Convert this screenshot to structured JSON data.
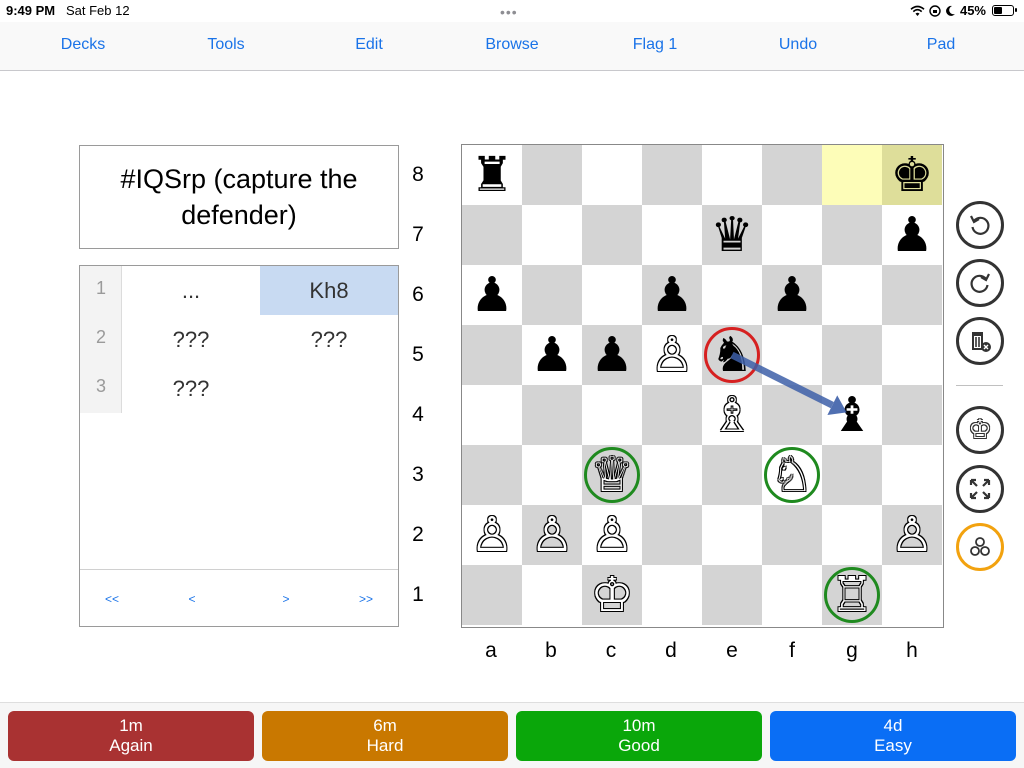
{
  "status_bar": {
    "time": "9:49 PM",
    "date": "Sat Feb 12",
    "battery": "45%",
    "battery_level": 0.45
  },
  "toolbar": {
    "items": [
      {
        "label": "Decks"
      },
      {
        "label": "Tools"
      },
      {
        "label": "Edit"
      },
      {
        "label": "Browse"
      },
      {
        "label": "Flag 1"
      },
      {
        "label": "Undo"
      },
      {
        "label": "Pad"
      }
    ],
    "color": "#1a73e8"
  },
  "question": {
    "text": "#IQSrp (capture the defender)"
  },
  "moves": {
    "rows": [
      {
        "num": "1",
        "white": "...",
        "black": "Kh8",
        "selected": "black"
      },
      {
        "num": "2",
        "white": "???",
        "black": "???"
      },
      {
        "num": "3",
        "white": "???",
        "black": ""
      }
    ],
    "nav": {
      "first": "<<",
      "prev": "<",
      "next": ">",
      "last": ">>"
    }
  },
  "board": {
    "ranks": [
      "8",
      "7",
      "6",
      "5",
      "4",
      "3",
      "2",
      "1"
    ],
    "files": [
      "a",
      "b",
      "c",
      "d",
      "e",
      "f",
      "g",
      "h"
    ],
    "highlight_squares": [
      "g8",
      "h8"
    ],
    "pieces": [
      {
        "sq": "a8",
        "glyph": "♜",
        "color": "black",
        "name": "black-rook"
      },
      {
        "sq": "h8",
        "glyph": "♚",
        "color": "black",
        "name": "black-king"
      },
      {
        "sq": "e7",
        "glyph": "♛",
        "color": "black",
        "name": "black-queen"
      },
      {
        "sq": "h7",
        "glyph": "♟",
        "color": "black",
        "name": "black-pawn"
      },
      {
        "sq": "a6",
        "glyph": "♟",
        "color": "black",
        "name": "black-pawn"
      },
      {
        "sq": "d6",
        "glyph": "♟",
        "color": "black",
        "name": "black-pawn"
      },
      {
        "sq": "f6",
        "glyph": "♟",
        "color": "black",
        "name": "black-pawn"
      },
      {
        "sq": "b5",
        "glyph": "♟",
        "color": "black",
        "name": "black-pawn"
      },
      {
        "sq": "c5",
        "glyph": "♟",
        "color": "black",
        "name": "black-pawn"
      },
      {
        "sq": "d5",
        "glyph": "♙",
        "color": "white",
        "name": "white-pawn"
      },
      {
        "sq": "e5",
        "glyph": "♞",
        "color": "black",
        "name": "black-knight",
        "ring": "red"
      },
      {
        "sq": "e4",
        "glyph": "♗",
        "color": "white",
        "name": "white-bishop"
      },
      {
        "sq": "g4",
        "glyph": "♝",
        "color": "black",
        "name": "black-bishop"
      },
      {
        "sq": "c3",
        "glyph": "♕",
        "color": "white",
        "name": "white-queen",
        "ring": "green"
      },
      {
        "sq": "f3",
        "glyph": "♘",
        "color": "white",
        "name": "white-knight",
        "ring": "green"
      },
      {
        "sq": "a2",
        "glyph": "♙",
        "color": "white",
        "name": "white-pawn"
      },
      {
        "sq": "b2",
        "glyph": "♙",
        "color": "white",
        "name": "white-pawn"
      },
      {
        "sq": "c2",
        "glyph": "♙",
        "color": "white",
        "name": "white-pawn"
      },
      {
        "sq": "h2",
        "glyph": "♙",
        "color": "white",
        "name": "white-pawn"
      },
      {
        "sq": "c1",
        "glyph": "♔",
        "color": "white",
        "name": "white-king"
      },
      {
        "sq": "g1",
        "glyph": "♖",
        "color": "white",
        "name": "white-rook",
        "ring": "green"
      }
    ],
    "arrow": {
      "from": "e5",
      "to": "g4",
      "color": "#3d5fa8"
    },
    "colors": {
      "light": "#ffffff",
      "dark": "#d4d4d4",
      "highlight_light": "#fdfdb8",
      "highlight_dark": "#dede9a",
      "ring_green": "#1f8a1f",
      "ring_red": "#d62020"
    }
  },
  "side_buttons": [
    {
      "name": "rotate-left-icon"
    },
    {
      "name": "rotate-right-icon"
    },
    {
      "name": "trash-clear-icon"
    },
    {
      "name": "king-icon"
    },
    {
      "name": "expand-icon"
    },
    {
      "name": "circles-icon",
      "accent": "#f2a20f"
    }
  ],
  "answers": [
    {
      "interval": "1m",
      "label": "Again",
      "color": "#a93232"
    },
    {
      "interval": "6m",
      "label": "Hard",
      "color": "#c97800"
    },
    {
      "interval": "10m",
      "label": "Good",
      "color": "#0aa70a"
    },
    {
      "interval": "4d",
      "label": "Easy",
      "color": "#0a6ef5"
    }
  ]
}
